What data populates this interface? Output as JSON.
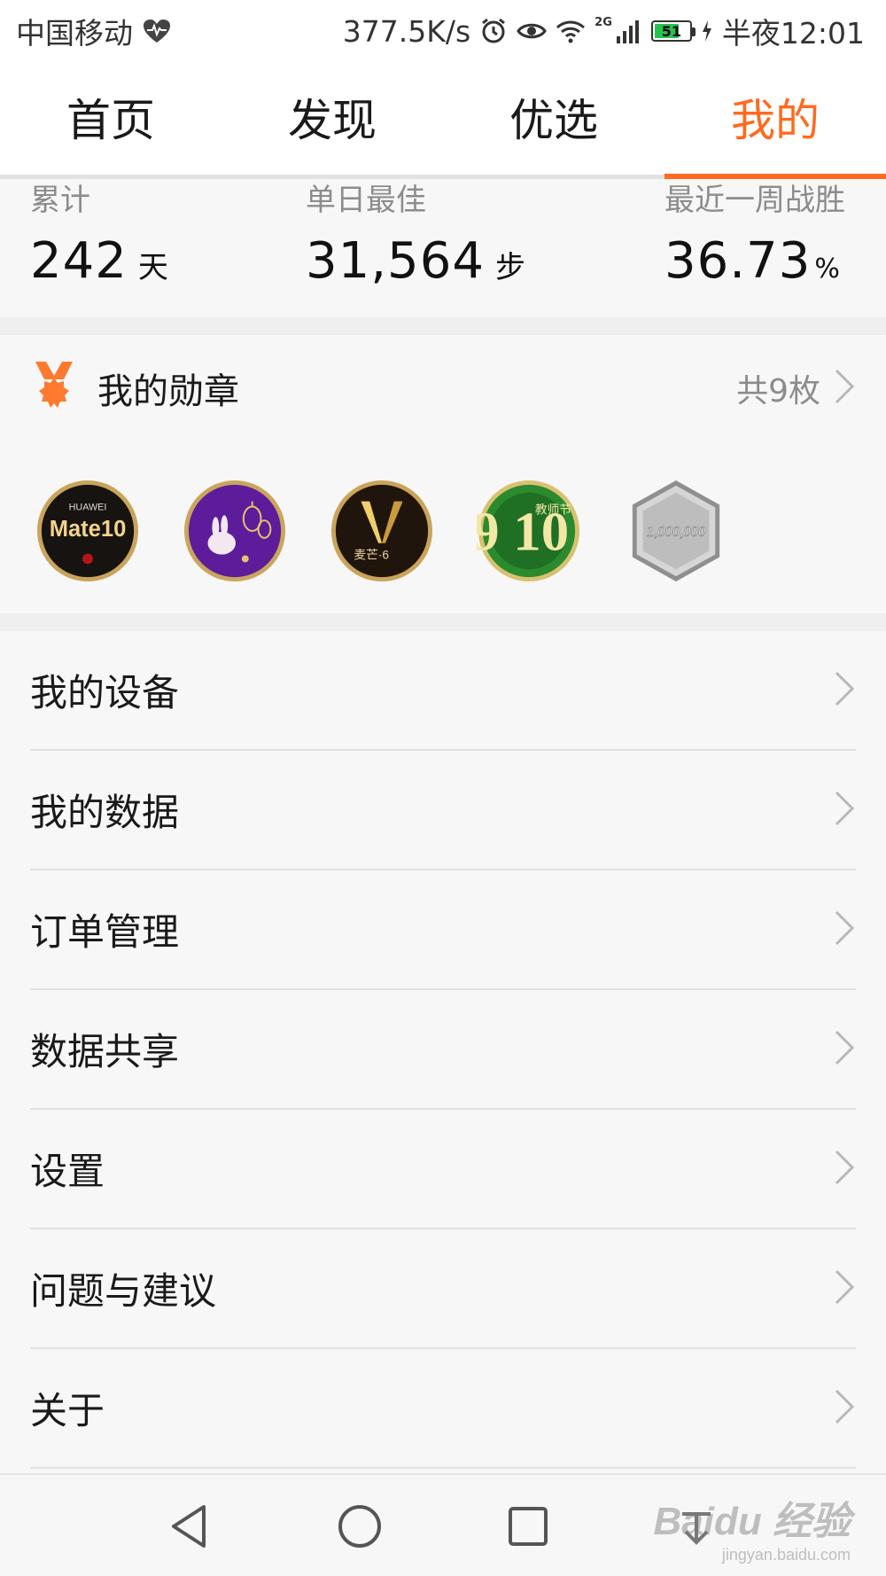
{
  "status_bar": {
    "carrier": "中国移动",
    "speed": "377.5K/s",
    "network_tag": "2G",
    "battery": "51",
    "time": "半夜12:01"
  },
  "tabs": [
    {
      "label": "首页",
      "active": false
    },
    {
      "label": "发现",
      "active": false
    },
    {
      "label": "优选",
      "active": false
    },
    {
      "label": "我的",
      "active": true
    }
  ],
  "stats": [
    {
      "label": "累计",
      "value": "242",
      "unit": "天"
    },
    {
      "label": "单日最佳",
      "value": "31,564",
      "unit": "步"
    },
    {
      "label": "最近一周战胜",
      "value": "36.73",
      "unit": "%"
    }
  ],
  "medals": {
    "title": "我的勋章",
    "count": "共9枚",
    "items": [
      {
        "name": "mate10-medal",
        "text": "Mate10",
        "sub": "HUAWEI"
      },
      {
        "name": "rabbit-lantern-medal",
        "text": ""
      },
      {
        "name": "mangguo-medal",
        "text": "麦芒·6"
      },
      {
        "name": "teachers-day-medal",
        "text": "9 10",
        "sub": "教师节"
      },
      {
        "name": "million-steps-medal",
        "text": "1,000,000"
      }
    ]
  },
  "menu": [
    {
      "label": "我的设备"
    },
    {
      "label": "我的数据"
    },
    {
      "label": "订单管理"
    },
    {
      "label": "数据共享"
    },
    {
      "label": "设置"
    },
    {
      "label": "问题与建议"
    },
    {
      "label": "关于"
    }
  ],
  "watermark": {
    "brand": "Baidu 经验",
    "url": "jingyan.baidu.com"
  },
  "colors": {
    "accent": "#ff6a1f",
    "medal_icon": "#ff7a2e"
  }
}
